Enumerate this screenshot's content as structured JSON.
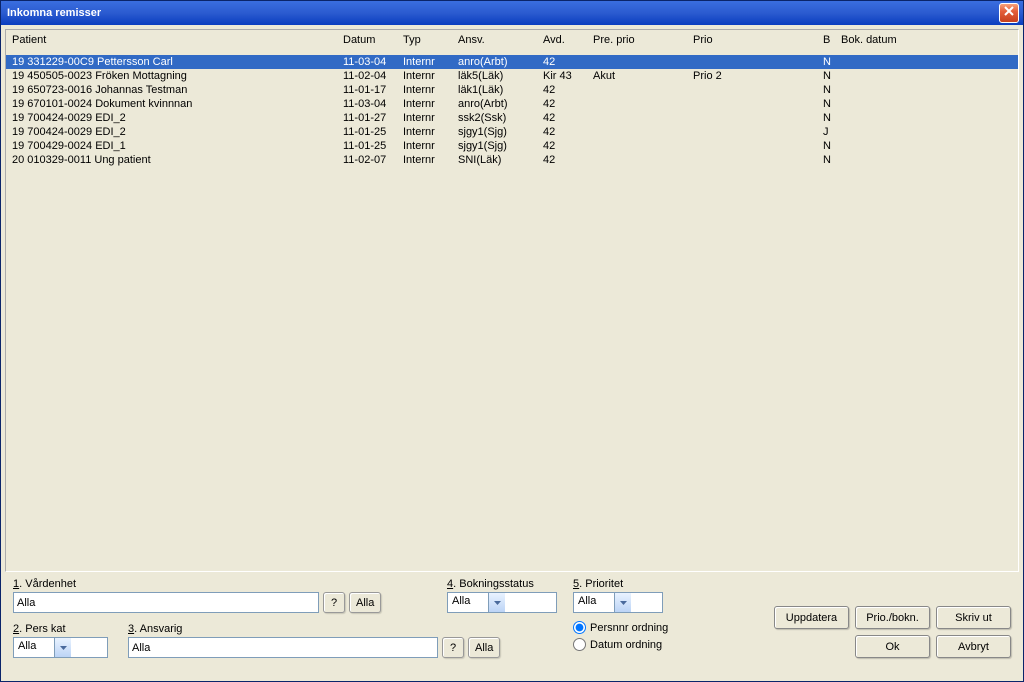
{
  "window": {
    "title": "Inkomna remisser"
  },
  "columns": {
    "patient": "Patient",
    "datum": "Datum",
    "typ": "Typ",
    "ansv": "Ansv.",
    "avd": "Avd.",
    "preprio": "Pre. prio",
    "prio": "Prio",
    "b": "B",
    "bokdatum": "Bok. datum"
  },
  "rows": [
    {
      "patient": "19 331229-00C9 Pettersson Carl",
      "datum": "11-03-04",
      "typ": "Internr",
      "ansv": "anro(Arbt)",
      "avd": "42",
      "preprio": "",
      "prio": "",
      "b": "N",
      "bokdatum": "",
      "selected": true
    },
    {
      "patient": "19 450505-0023 Fröken Mottagning",
      "datum": "11-02-04",
      "typ": "Internr",
      "ansv": "läk5(Läk)",
      "avd": "Kir 43",
      "preprio": "Akut",
      "prio": "Prio 2",
      "b": "N",
      "bokdatum": ""
    },
    {
      "patient": "19 650723-0016 Johannas Testman",
      "datum": "11-01-17",
      "typ": "Internr",
      "ansv": "läk1(Läk)",
      "avd": "42",
      "preprio": "",
      "prio": "",
      "b": "N",
      "bokdatum": ""
    },
    {
      "patient": "19 670101-0024 Dokument kvinnnan",
      "datum": "11-03-04",
      "typ": "Internr",
      "ansv": "anro(Arbt)",
      "avd": "42",
      "preprio": "",
      "prio": "",
      "b": "N",
      "bokdatum": ""
    },
    {
      "patient": "19 700424-0029 EDI_2",
      "datum": "11-01-27",
      "typ": "Internr",
      "ansv": "ssk2(Ssk)",
      "avd": "42",
      "preprio": "",
      "prio": "",
      "b": "N",
      "bokdatum": ""
    },
    {
      "patient": "19 700424-0029 EDI_2",
      "datum": "11-01-25",
      "typ": "Internr",
      "ansv": "sjgy1(Sjg)",
      "avd": "42",
      "preprio": "",
      "prio": "",
      "b": "J",
      "bokdatum": ""
    },
    {
      "patient": "19 700429-0024 EDI_1",
      "datum": "11-01-25",
      "typ": "Internr",
      "ansv": "sjgy1(Sjg)",
      "avd": "42",
      "preprio": "",
      "prio": "",
      "b": "N",
      "bokdatum": ""
    },
    {
      "patient": "20 010329-0011 Ung patient",
      "datum": "11-02-07",
      "typ": "Internr",
      "ansv": "SNI(Läk)",
      "avd": "42",
      "preprio": "",
      "prio": "",
      "b": "N",
      "bokdatum": ""
    }
  ],
  "filters": {
    "vardenhet_label_prefix": "1",
    "vardenhet_label": ". Vårdenhet",
    "vardenhet_value": "Alla",
    "perskat_label_prefix": "2",
    "perskat_label": ". Pers kat",
    "perskat_value": "Alla",
    "ansvarig_label_prefix": "3",
    "ansvarig_label": ". Ansvarig",
    "ansvarig_value": "Alla",
    "bokstatus_label_prefix": "4",
    "bokstatus_label": ". Bokningsstatus",
    "bokstatus_value": "Alla",
    "prioritet_label_prefix": "5",
    "prioritet_label": ". Prioritet",
    "prioritet_value": "Alla",
    "q_label": "?",
    "alla_btn": "Alla",
    "radio_persnr_prefix": "P",
    "radio_persnr_rest": "ersnnr ordning",
    "radio_datum_prefix": "D",
    "radio_datum_rest": "atum ordning"
  },
  "buttons": {
    "uppdatera": "Uppdatera",
    "uppdatera_u": "U",
    "priobokn_pre": "P",
    "priobokn_u": "r",
    "priobokn_rest": "io./bokn.",
    "skrivut": "kriv ut",
    "skrivut_u": "S",
    "ok": "k",
    "ok_u": "O",
    "avbryt": "vbryt",
    "avbryt_u": "A"
  }
}
